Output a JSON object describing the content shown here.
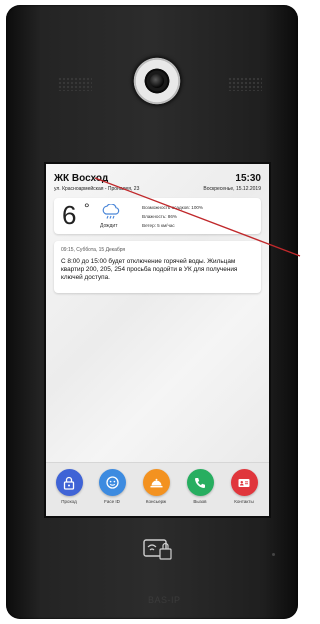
{
  "screen": {
    "header": {
      "title": "ЖК Восход",
      "time": "15:30",
      "address": "ул. Красноармейская - Проналея, 23",
      "date": "Воскресенье, 15.12.2019"
    },
    "weather": {
      "temperature": "6",
      "degree": "°",
      "condition": "Дождит",
      "icon": "rain-cloud-icon",
      "precipitation": "Возможность осадков: 100%",
      "humidity": "Влажность: 86%",
      "wind": "Ветер: 5 км/час"
    },
    "notice": {
      "timestamp": "09:15, Суббота, 15 Декабря",
      "message": "С 8:00 до 15:00 будет отключение горячей воды. Жильцам квартир 200, 205, 254 просьба подойти в УК для получения ключей доступа."
    },
    "dock": [
      {
        "label": "Проход",
        "icon": "lock-icon",
        "color": "#3F63D6"
      },
      {
        "label": "Face ID",
        "icon": "face-icon",
        "color": "#3D8BE0"
      },
      {
        "label": "Консьерж",
        "icon": "bell-icon",
        "color": "#F39220"
      },
      {
        "label": "Вызов",
        "icon": "phone-icon",
        "color": "#27AE60"
      },
      {
        "label": "Контакты",
        "icon": "contacts-icon",
        "color": "#E0363C"
      }
    ]
  },
  "device": {
    "brand": "BAS-IP"
  },
  "colors": {
    "annotation_line": "#C0282B",
    "body": "#242424"
  }
}
